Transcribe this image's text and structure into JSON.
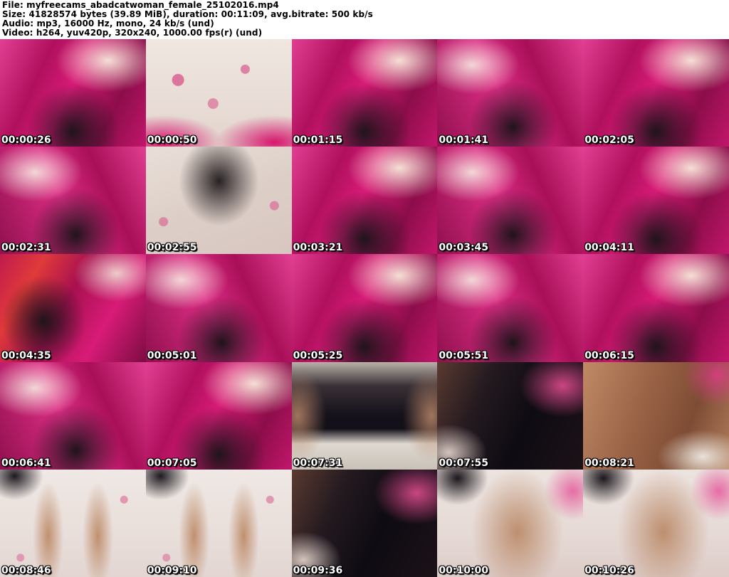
{
  "header": {
    "file_line": "File: myfreecams_abadcatwoman_female_25102016.mp4",
    "size_line": "Size: 41828574 bytes (39.89 MiB), duration: 00:11:09, avg.bitrate: 500 kb/s",
    "audio_line": "Audio: mp3, 16000 Hz, mono, 24 kb/s (und)",
    "video_line": "Video: h264, yuv420p, 320x240, 1000.00 fps(r) (und)"
  },
  "media": {
    "filename": "myfreecams_abadcatwoman_female_25102016.mp4",
    "size_bytes": "41828574",
    "size_human": "39.89 MiB",
    "duration": "00:11:09",
    "avg_bitrate": "500 kb/s",
    "audio_codec": "mp3",
    "audio_sample_rate": "16000 Hz",
    "audio_channels": "mono",
    "audio_bitrate": "24 kb/s",
    "audio_lang": "(und)",
    "video_codec": "h264",
    "pixel_format": "yuv420p",
    "resolution": "320x240",
    "fps": "1000.00 fps(r)",
    "video_lang": "(und)"
  },
  "colors": {
    "header_bg": "#ffffff",
    "header_text": "#000000",
    "timestamp_text": "#ffffff",
    "timestamp_outline": "#000000",
    "accent_magenta": "#d81b77"
  },
  "grid": {
    "columns": 5,
    "rows": 5
  },
  "thumbnails": [
    {
      "time": "00:00:26",
      "variant": "magenta-a"
    },
    {
      "time": "00:00:50",
      "variant": "floral-a"
    },
    {
      "time": "00:01:15",
      "variant": "magenta-a"
    },
    {
      "time": "00:01:41",
      "variant": "magenta-b"
    },
    {
      "time": "00:02:05",
      "variant": "magenta-a"
    },
    {
      "time": "00:02:31",
      "variant": "magenta-b"
    },
    {
      "time": "00:02:55",
      "variant": "floral-b"
    },
    {
      "time": "00:03:21",
      "variant": "magenta-a"
    },
    {
      "time": "00:03:45",
      "variant": "magenta-b"
    },
    {
      "time": "00:04:11",
      "variant": "magenta-a"
    },
    {
      "time": "00:04:35",
      "variant": "magenta-red"
    },
    {
      "time": "00:05:01",
      "variant": "magenta-b"
    },
    {
      "time": "00:05:25",
      "variant": "magenta-a"
    },
    {
      "time": "00:05:51",
      "variant": "magenta-b"
    },
    {
      "time": "00:06:15",
      "variant": "magenta-a"
    },
    {
      "time": "00:06:41",
      "variant": "magenta-b"
    },
    {
      "time": "00:07:05",
      "variant": "magenta-a"
    },
    {
      "time": "00:07:31",
      "variant": "closeup-white"
    },
    {
      "time": "00:07:55",
      "variant": "closeup-dark"
    },
    {
      "time": "00:08:21",
      "variant": "closeup-tan"
    },
    {
      "time": "00:08:46",
      "variant": "sheet-a"
    },
    {
      "time": "00:09:10",
      "variant": "sheet-a"
    },
    {
      "time": "00:09:36",
      "variant": "closeup-dark"
    },
    {
      "time": "00:10:00",
      "variant": "sheet-b"
    },
    {
      "time": "00:10:26",
      "variant": "sheet-b"
    }
  ]
}
